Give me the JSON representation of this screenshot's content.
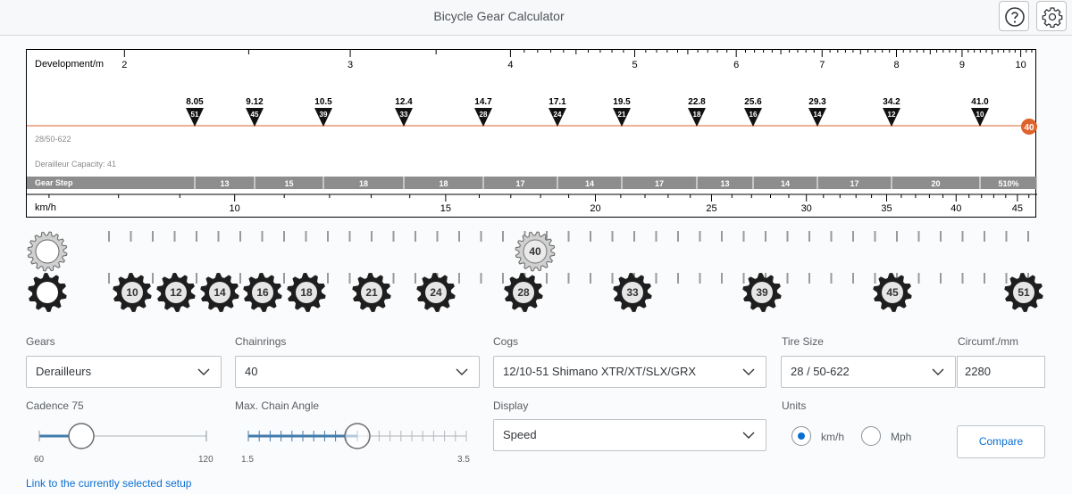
{
  "header": {
    "title": "Bicycle Gear Calculator",
    "help_icon": "help-circle-icon",
    "settings_icon": "gear-icon"
  },
  "chart": {
    "development_label": "Development/m",
    "development_ticks": [
      "2",
      "3",
      "4",
      "5",
      "6",
      "7",
      "8",
      "9",
      "10"
    ],
    "gear_ratios": [
      {
        "ratio": "8.05",
        "cog": "51"
      },
      {
        "ratio": "9.12",
        "cog": "45"
      },
      {
        "ratio": "10.5",
        "cog": "39"
      },
      {
        "ratio": "12.4",
        "cog": "33"
      },
      {
        "ratio": "14.7",
        "cog": "28"
      },
      {
        "ratio": "17.1",
        "cog": "24"
      },
      {
        "ratio": "19.5",
        "cog": "21"
      },
      {
        "ratio": "22.8",
        "cog": "18"
      },
      {
        "ratio": "25.6",
        "cog": "16"
      },
      {
        "ratio": "29.3",
        "cog": "14"
      },
      {
        "ratio": "34.2",
        "cog": "12"
      },
      {
        "ratio": "41.0",
        "cog": "10"
      }
    ],
    "chainring_badge": "40",
    "setup_name": "28/50-622",
    "capacity": "Derailleur Capacity: 41",
    "gear_step_label": "Gear Step",
    "gear_steps": [
      "13",
      "15",
      "18",
      "18",
      "17",
      "14",
      "17",
      "13",
      "14",
      "17",
      "20",
      "510%"
    ],
    "speed_label": "km/h",
    "speed_ticks": [
      "10",
      "15",
      "20",
      "25",
      "30",
      "35",
      "40",
      "45"
    ],
    "accent_color": "#e0622b"
  },
  "drivetrain": {
    "chainring": "40",
    "cogs": [
      "10",
      "12",
      "14",
      "16",
      "18",
      "21",
      "24",
      "28",
      "33",
      "39",
      "45",
      "51"
    ]
  },
  "form": {
    "gears_label": "Gears",
    "gears_value": "Derailleurs",
    "chainrings_label": "Chainrings",
    "chainrings_value": "40",
    "cogs_label": "Cogs",
    "cogs_value": "12/10-51 Shimano XTR/XT/SLX/GRX",
    "tire_label": "Tire Size",
    "tire_value": "28 / 50-622",
    "circ_label": "Circumf./mm",
    "circ_value": "2280",
    "cadence_label": "Cadence 75",
    "cadence_min": "60",
    "cadence_max": "120",
    "cadence_value": 75,
    "angle_label": "Max. Chain Angle",
    "angle_min": "1.5",
    "angle_max": "3.5",
    "angle_value": 2.5,
    "display_label": "Display",
    "display_value": "Speed",
    "units_label": "Units",
    "unit_kmh": "km/h",
    "unit_mph": "Mph",
    "selected_unit": "km/h",
    "compare_label": "Compare",
    "link_text": "Link to the currently selected setup"
  }
}
